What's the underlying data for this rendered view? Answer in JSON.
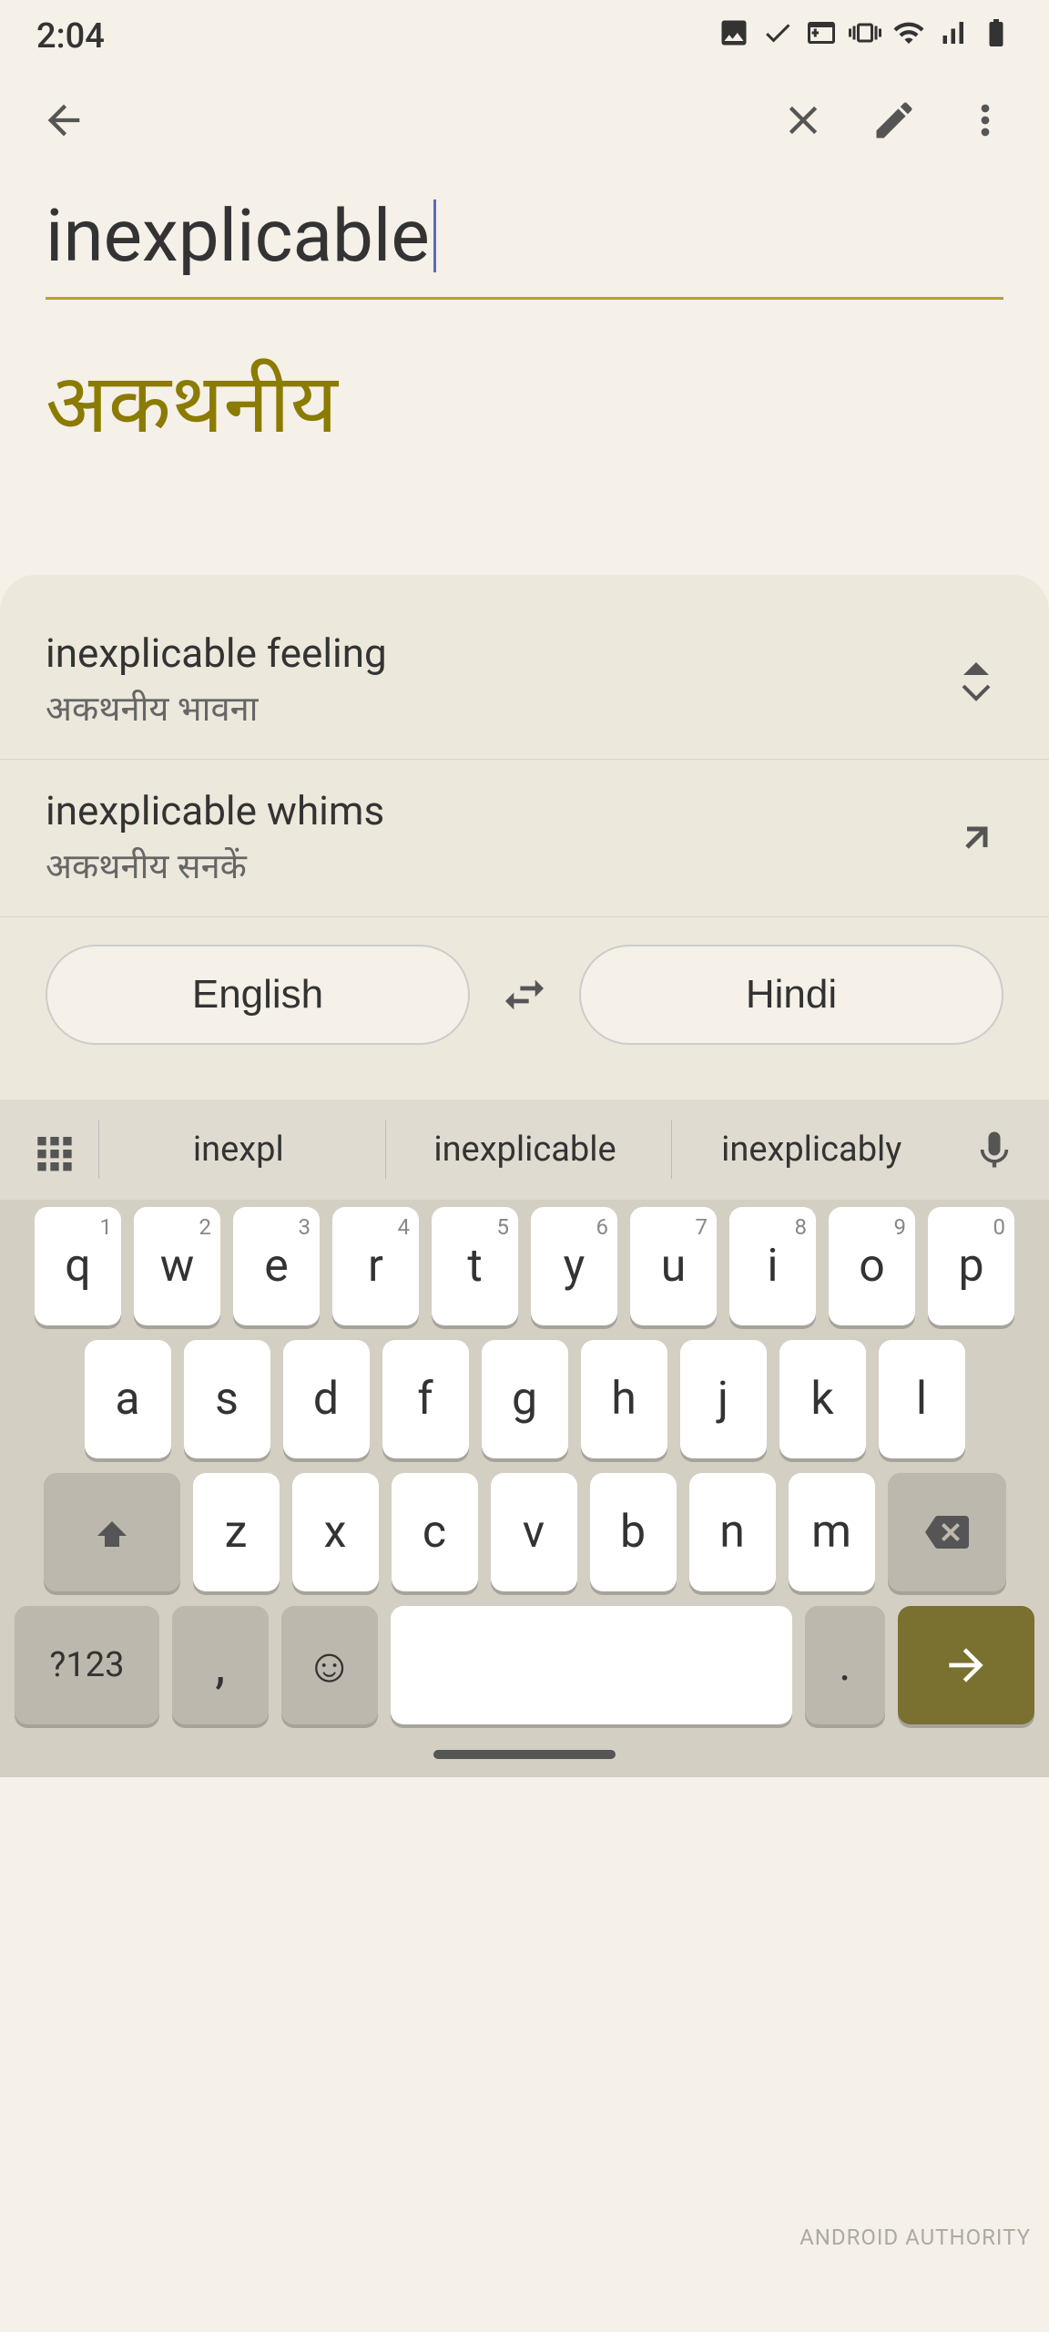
{
  "status": {
    "time": "2:04",
    "icons": [
      "photo",
      "check",
      "terminal",
      "vibrate",
      "wifi",
      "signal",
      "battery"
    ]
  },
  "toolbar": {
    "back_label": "back",
    "clear_label": "clear",
    "annotate_label": "annotate",
    "more_label": "more"
  },
  "translation": {
    "source_text": "inexplicable",
    "translated_text": "अकथनीय"
  },
  "suggestions": [
    {
      "main": "inexplicable feeling",
      "translation": "अकथनीय भावना"
    },
    {
      "main": "inexplicable whims",
      "translation": "अकथनीय सनकें"
    }
  ],
  "language_switcher": {
    "source_lang": "English",
    "target_lang": "Hindi",
    "swap_label": "swap languages"
  },
  "keyboard": {
    "suggestions": [
      "inexpl",
      "inexplicable",
      "inexplicably"
    ],
    "rows": [
      [
        "q",
        "w",
        "e",
        "r",
        "t",
        "y",
        "u",
        "i",
        "o",
        "p"
      ],
      [
        "a",
        "s",
        "d",
        "f",
        "g",
        "h",
        "j",
        "k",
        "l"
      ],
      [
        "z",
        "x",
        "c",
        "v",
        "b",
        "n",
        "m"
      ]
    ],
    "numbers": [
      "1",
      "2",
      "3",
      "4",
      "5",
      "6",
      "7",
      "8",
      "9",
      "0"
    ],
    "special_keys": {
      "shift": "⇧",
      "delete": "⌫",
      "numbers": "?123",
      "comma": ",",
      "emoji": "☺",
      "period": ".",
      "enter": "→"
    }
  },
  "watermark": "ANDROID AUTHORITY"
}
